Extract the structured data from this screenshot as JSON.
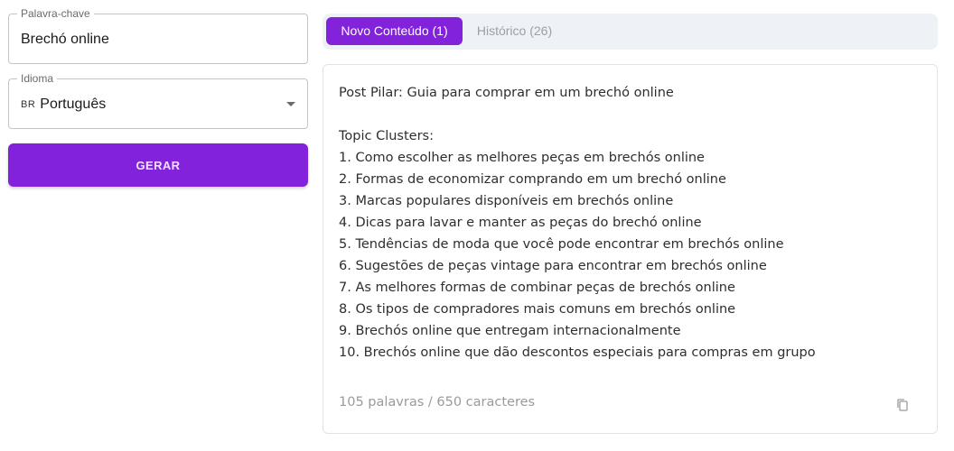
{
  "form": {
    "keyword": {
      "legend": "Palavra-chave",
      "value": "Brechó online"
    },
    "language": {
      "legend": "Idioma",
      "flag_code": "BR",
      "value": "Português"
    },
    "generate_label": "GERAR"
  },
  "tabs": [
    {
      "label": "Novo Conteúdo (1)",
      "active": true
    },
    {
      "label": "Histórico (26)",
      "active": false
    }
  ],
  "content": {
    "pillar": "Post Pilar: Guia para comprar em um brechó online",
    "clusters_heading": "Topic Clusters:",
    "clusters": [
      "1. Como escolher as melhores peças em brechós online",
      "2. Formas de economizar comprando em um brechó online",
      "3. Marcas populares disponíveis em brechós online",
      "4. Dicas para lavar e manter as peças do brechó online",
      "5. Tendências de moda que você pode encontrar em brechós online",
      "6. Sugestões de peças vintage para encontrar em brechós online",
      "7. As melhores formas de combinar peças de brechós online",
      "8. Os tipos de compradores mais comuns em brechós online",
      "9. Brechós online que entregam internacionalmente",
      "10. Brechós online que dão descontos especiais para compras em grupo"
    ],
    "stats": "105 palavras / 650 caracteres"
  },
  "icons": {
    "language_dropdown": "chevron-down-icon",
    "copy": "copy-icon"
  },
  "colors": {
    "accent": "#8322db",
    "tab_bar_bg": "#eef1f6",
    "inactive_tab_text": "#9b9fa8"
  }
}
